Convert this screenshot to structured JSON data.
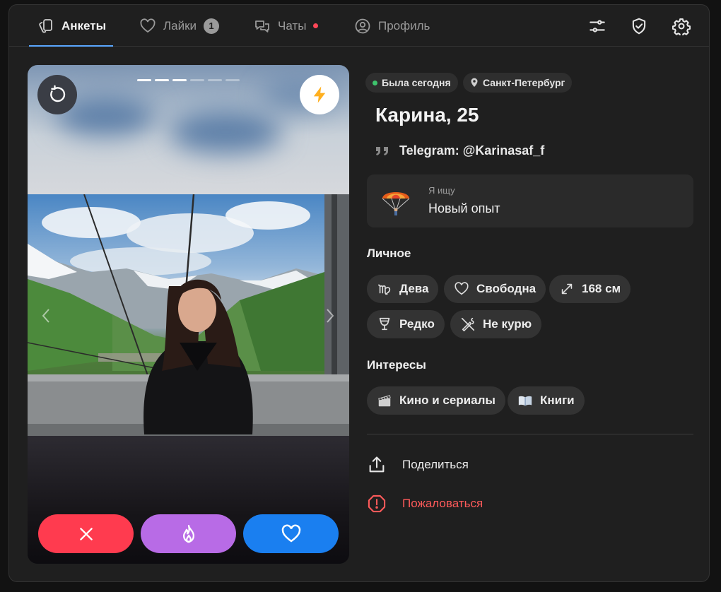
{
  "tabs": [
    {
      "label": "Анкеты"
    },
    {
      "label": "Лайки",
      "badge": "1"
    },
    {
      "label": "Чаты"
    },
    {
      "label": "Профиль"
    }
  ],
  "header_icons": [
    "sliders-icon",
    "shield-check-icon",
    "gear-icon"
  ],
  "photo": {
    "total": 6,
    "current": 3
  },
  "status": {
    "online": "Была сегодня",
    "city": "Санкт-Петербург"
  },
  "profile": {
    "name_age": "Карина, 25",
    "bio": "Telegram: @Karinasaf_f"
  },
  "looking_for": {
    "label": "Я ищу",
    "value": "Новый опыт"
  },
  "personal": {
    "title": "Личное",
    "items": [
      {
        "label": "Дева",
        "icon": "virgo-icon"
      },
      {
        "label": "Свободна",
        "icon": "heart-icon"
      },
      {
        "label": "168 см",
        "icon": "resize-icon"
      },
      {
        "label": "Редко",
        "icon": "wine-glass-icon"
      },
      {
        "label": "Не курю",
        "icon": "no-smoking-icon"
      }
    ]
  },
  "interests": {
    "title": "Интересы",
    "items": [
      {
        "label": "Кино и сериалы",
        "icon": "clapper-icon"
      },
      {
        "label": "Книги",
        "icon": "book-icon"
      }
    ]
  },
  "actions": {
    "share": "Поделиться",
    "report": "Пожаловаться"
  },
  "colors": {
    "accent": "#5aa7ff",
    "dislike": "#ff3b4f",
    "superlike": "#b86be6",
    "like": "#1a7ff0",
    "report": "#ff5a5a",
    "online_dot": "#3ec46d"
  }
}
